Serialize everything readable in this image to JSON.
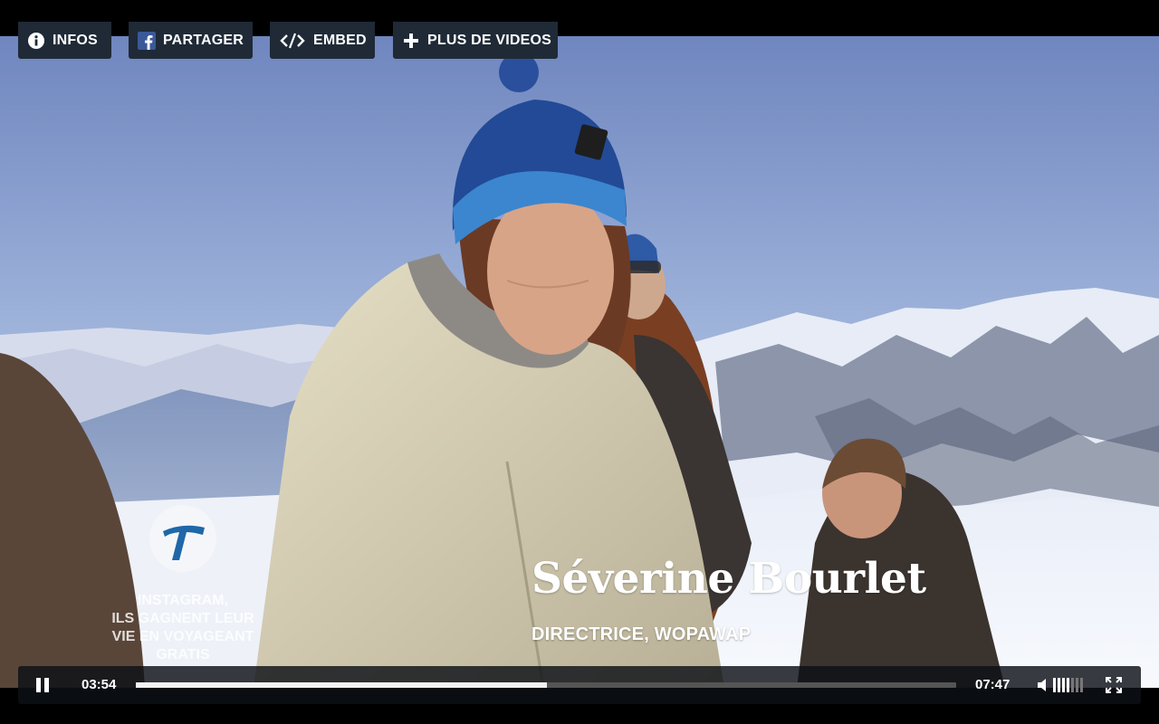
{
  "toolbar": {
    "infos_label": "INFOS",
    "share_label": "PARTAGER",
    "embed_label": "EMBED",
    "more_label": "PLUS DE VIDEOS"
  },
  "brand": {
    "logo_letter": "T",
    "caption_lines": [
      "INSTAGRAM,",
      "ILS GAGNENT LEUR",
      "VIE EN VOYAGEANT",
      "GRATIS"
    ]
  },
  "overlay": {
    "name": "Séverine Bourlet",
    "role": "DIRECTRICE, WOPAWAP"
  },
  "player": {
    "current_time": "03:54",
    "duration": "07:47",
    "progress_fraction": 0.501,
    "volume_level": 0.6
  },
  "icons": {
    "info": "info-icon",
    "facebook": "facebook-icon",
    "embed": "code-icon",
    "more": "plus-icon",
    "pause": "pause-icon",
    "volume": "speaker-icon",
    "fullscreen": "fullscreen-icon"
  },
  "colors": {
    "button_bg": "#1f2a36",
    "facebook": "#3b5998",
    "progress_fill": "#f2f2f2",
    "progress_track": "#555555"
  }
}
